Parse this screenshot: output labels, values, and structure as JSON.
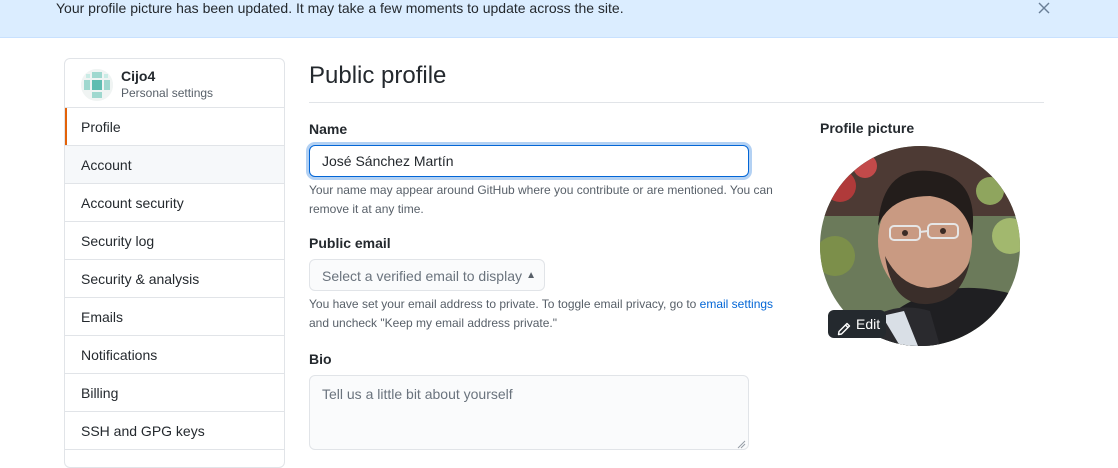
{
  "flash": {
    "message": "Your profile picture has been updated. It may take a few moments to update across the site."
  },
  "sidebar": {
    "username": "Cijo4",
    "subtitle": "Personal settings",
    "items": [
      {
        "label": "Profile"
      },
      {
        "label": "Account"
      },
      {
        "label": "Account security"
      },
      {
        "label": "Security log"
      },
      {
        "label": "Security & analysis"
      },
      {
        "label": "Emails"
      },
      {
        "label": "Notifications"
      },
      {
        "label": "Billing"
      },
      {
        "label": "SSH and GPG keys"
      }
    ]
  },
  "main": {
    "title": "Public profile",
    "name_label": "Name",
    "name_value": "José Sánchez Martín",
    "name_note": "Your name may appear around GitHub where you contribute or are mentioned. You can remove it at any time.",
    "email_label": "Public email",
    "email_select": "Select a verified email to display",
    "email_note_before": "You have set your email address to private. To toggle email privacy, go to",
    "email_note_link": "email settings",
    "email_note_after": "and uncheck \"Keep my email address private.\"",
    "bio_label": "Bio",
    "bio_placeholder": "Tell us a little bit about yourself"
  },
  "profile_picture": {
    "label": "Profile picture",
    "edit_label": "Edit"
  },
  "colors": {
    "flash_bg": "#dbedff",
    "selected_accent": "#e36209",
    "link": "#0366d6",
    "focus_border": "#0366d6"
  }
}
